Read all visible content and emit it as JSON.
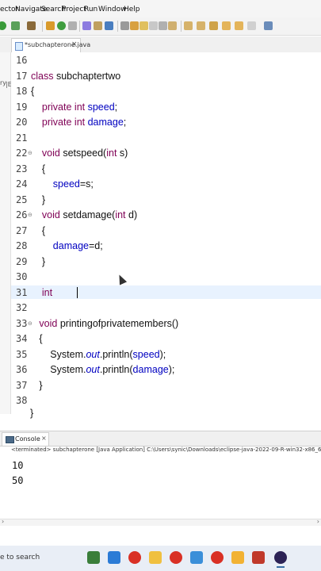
{
  "menu": {
    "items": [
      "ector",
      "Navigate",
      "Search",
      "Project",
      "Run",
      "Window",
      "Help"
    ]
  },
  "editor_tab": {
    "title": "*subchapterone.java",
    "close": "×"
  },
  "left_strip": {
    "fragments": [
      "ry",
      "|E"
    ]
  },
  "code_lines": [
    {
      "n": "16",
      "fold": "",
      "text": ""
    },
    {
      "n": "17",
      "fold": "",
      "text": "class subchaptertwo"
    },
    {
      "n": "18",
      "fold": "",
      "text": "{"
    },
    {
      "n": "19",
      "fold": "",
      "text": "    private int speed;"
    },
    {
      "n": "20",
      "fold": "",
      "text": "    private int damage;"
    },
    {
      "n": "21",
      "fold": "",
      "text": ""
    },
    {
      "n": "22",
      "fold": "⊖",
      "text": "    void setspeed(int s)"
    },
    {
      "n": "23",
      "fold": "",
      "text": "    {"
    },
    {
      "n": "24",
      "fold": "",
      "text": "        speed=s;"
    },
    {
      "n": "25",
      "fold": "",
      "text": "    }"
    },
    {
      "n": "26",
      "fold": "⊖",
      "text": "    void setdamage(int d)"
    },
    {
      "n": "27",
      "fold": "",
      "text": "    {"
    },
    {
      "n": "28",
      "fold": "",
      "text": "        damage=d;"
    },
    {
      "n": "29",
      "fold": "",
      "text": "    }"
    },
    {
      "n": "30",
      "fold": "",
      "text": ""
    },
    {
      "n": "31",
      "fold": "",
      "text": "    int "
    },
    {
      "n": "32",
      "fold": "",
      "text": ""
    },
    {
      "n": "33",
      "fold": "⊖",
      "text": "   void printingofprivatemembers()"
    },
    {
      "n": "34",
      "fold": "",
      "text": "   {"
    },
    {
      "n": "35",
      "fold": "",
      "text": "       System.out.println(speed);"
    },
    {
      "n": "36",
      "fold": "",
      "text": "       System.out.println(damage);"
    },
    {
      "n": "37",
      "fold": "",
      "text": "   }"
    },
    {
      "n": "38",
      "fold": "",
      "text": ""
    }
  ],
  "closing_brace_partial": "}",
  "console": {
    "tab_label": "Console",
    "close": "×",
    "header": "<terminated> subchapterone [Java Application] C:\\Users\\synic\\Downloads\\eclipse-java-2022-09-R-win32-x86_64\\eclipse\\plugins\\org.eclip",
    "output": [
      "10",
      "50"
    ]
  },
  "taskbar": {
    "search_text": "e to search"
  },
  "colors": {
    "keyword": "#7f0055",
    "field": "#0000c0",
    "current_line": "#e8f2fe"
  }
}
